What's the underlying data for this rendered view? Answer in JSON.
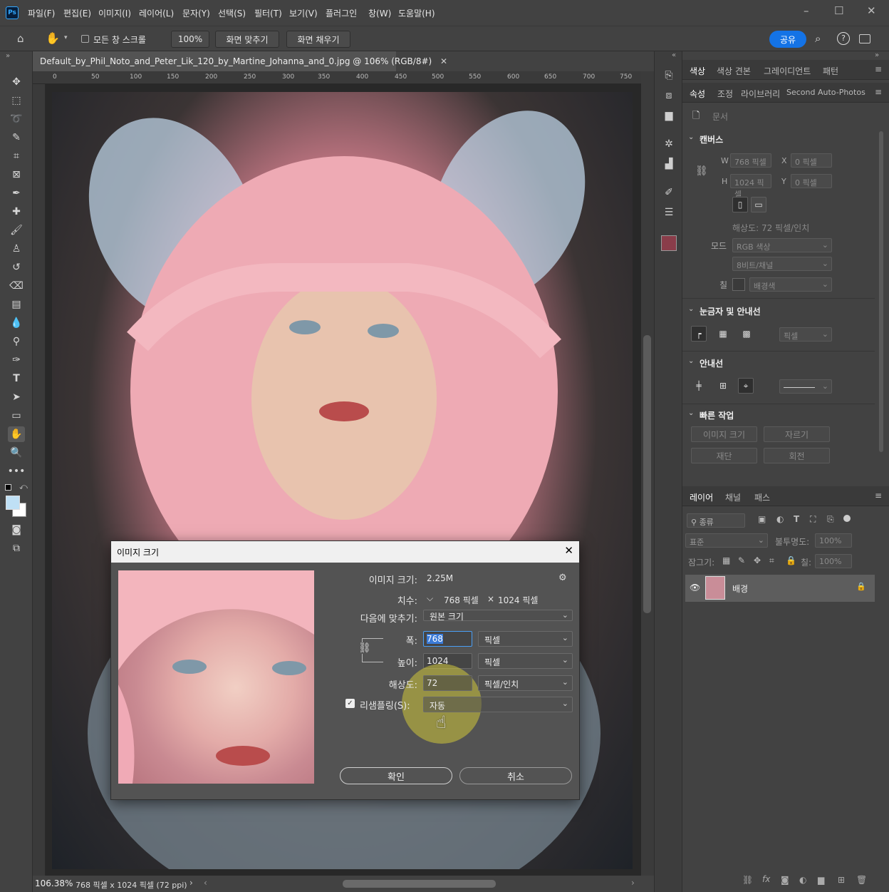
{
  "menubar": {
    "logo": "Ps",
    "items": [
      "파일(F)",
      "편집(E)",
      "이미지(I)",
      "레이어(L)",
      "문자(Y)",
      "선택(S)",
      "필터(T)",
      "보기(V)",
      "플러그인",
      "창(W)",
      "도움말(H)"
    ]
  },
  "options": {
    "scroll_all_label": "모든 창 스크롤",
    "zoom_value": "100%",
    "fit_screen": "화면 맞추기",
    "fill_screen": "화면 채우기",
    "share": "공유"
  },
  "document": {
    "tab_title": "Default_by_Phil_Noto_and_Peter_Lik_120_by_Martine_Johanna_and_0.jpg @ 106% (RGB/8#)",
    "ruler_marks": [
      "0",
      "50",
      "100",
      "150",
      "200",
      "250",
      "300",
      "350",
      "400",
      "450",
      "500",
      "550",
      "600",
      "650",
      "700",
      "750"
    ],
    "zoom": "106.38%",
    "status_info": "768 픽셀 x 1024 픽셀 (72 ppi)"
  },
  "panels": {
    "top_tabs": [
      "색상",
      "색상 견본",
      "그레이디언트",
      "패턴"
    ],
    "second_tabs": [
      "속성",
      "조정",
      "라이브러리",
      "Second Auto-Photos"
    ],
    "doc_label": "문서",
    "canvas_section": "캔버스",
    "w_label": "W",
    "w_value": "768 픽셀",
    "h_label": "H",
    "h_value": "1024 픽셀",
    "x_label": "X",
    "x_value": "0 픽셀",
    "y_label": "Y",
    "y_value": "0 픽셀",
    "resolution": "해상도: 72 픽셀/인치",
    "mode_label": "모드",
    "mode_value": "RGB 색상",
    "depth_value": "8비트/채널",
    "fill_label": "칠",
    "fill_value": "배경색",
    "rulers_section": "눈금자 및 안내선",
    "rulers_unit": "픽셀",
    "guides_section": "안내선",
    "quick_section": "빠른 작업",
    "quick_buttons": [
      "이미지 크기",
      "자르기",
      "재단",
      "회전"
    ]
  },
  "layers": {
    "tabs": [
      "레이어",
      "채널",
      "패스"
    ],
    "kind_filter": "종류",
    "blend_mode": "표준",
    "opacity_label": "불투명도:",
    "opacity_value": "100%",
    "lock_label": "잠그기:",
    "fill_label": "칠:",
    "fill_value": "100%",
    "layer_name": "배경"
  },
  "dialog": {
    "title": "이미지 크기",
    "image_size_label": "이미지 크기:",
    "image_size_value": "2.25M",
    "dimensions_label": "치수:",
    "dimensions_w": "768 픽셀",
    "dimensions_x": "×",
    "dimensions_h": "1024 픽셀",
    "fit_label": "다음에 맞추기:",
    "fit_value": "원본 크기",
    "width_label": "폭:",
    "width_value": "768",
    "width_unit": "픽셀",
    "height_label": "높이:",
    "height_value": "1024",
    "height_unit": "픽셀",
    "resolution_label": "해상도:",
    "resolution_value": "72",
    "resolution_unit": "픽셀/인치",
    "resample_label": "리샘플링(S):",
    "resample_value": "자동",
    "ok": "확인",
    "cancel": "취소"
  }
}
